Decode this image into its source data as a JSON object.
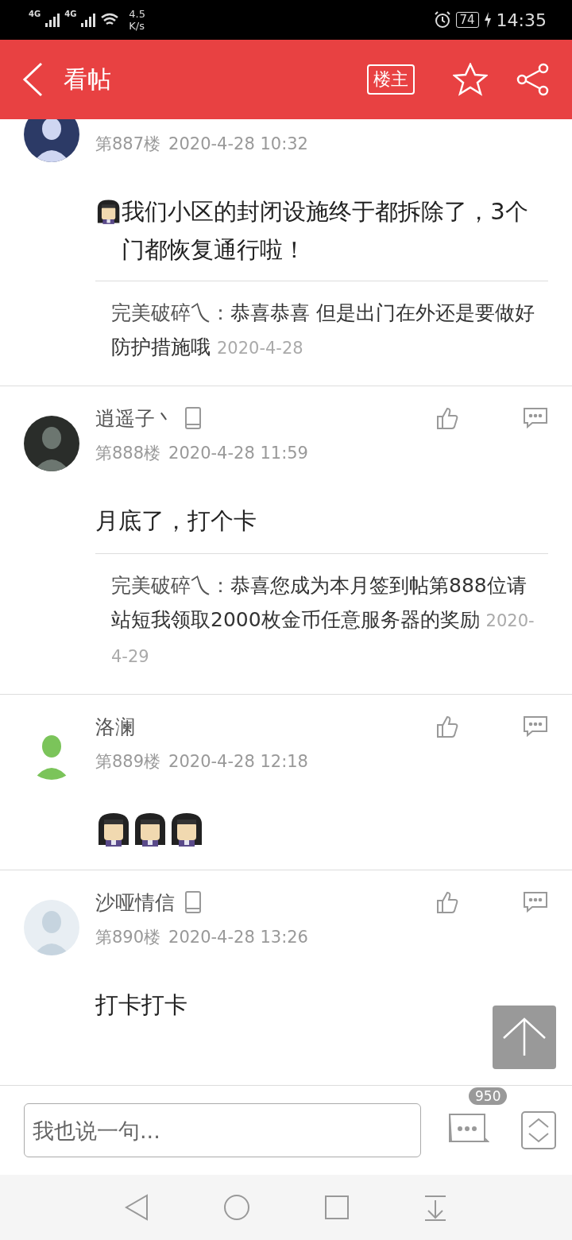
{
  "status_bar": {
    "net1": "4G",
    "net2": "4G",
    "speed": "4.5",
    "speed_unit": "K/s",
    "battery": "74",
    "time": "14:35"
  },
  "header": {
    "title": "看帖",
    "owner_tag": "楼主"
  },
  "posts": [
    {
      "floor": "第887楼",
      "time": "2020-4-28 10:32",
      "content": [
        {
          "kind": "sticker"
        },
        {
          "kind": "text",
          "text": "我们小区的封闭设施终于都拆除了，3个门都恢复通行啦！"
        }
      ],
      "reply": {
        "author": "完美破碎乀：",
        "text": "恭喜恭喜 但是出门在外还是要做好防护措施哦",
        "date": "2020-4-28"
      }
    },
    {
      "name": "逍遥子丶",
      "device": true,
      "floor": "第888楼",
      "time": "2020-4-28 11:59",
      "content": [
        {
          "kind": "text",
          "text": "月底了，打个卡"
        }
      ],
      "reply": {
        "author": "完美破碎乀：",
        "text": "恭喜您成为本月签到帖第888位请站短我领取2000枚金币任意服务器的奖励",
        "date": "2020-4-29"
      }
    },
    {
      "name": "洛澜",
      "device": false,
      "floor": "第889楼",
      "time": "2020-4-28 12:18",
      "content": [
        {
          "kind": "sticker"
        },
        {
          "kind": "sticker"
        },
        {
          "kind": "sticker"
        }
      ]
    },
    {
      "name": "沙哑情信",
      "device": true,
      "floor": "第890楼",
      "time": "2020-4-28 13:26",
      "content": [
        {
          "kind": "text",
          "text": "打卡打卡"
        }
      ]
    }
  ],
  "composer": {
    "placeholder": "我也说一句...",
    "comment_count": "950"
  }
}
